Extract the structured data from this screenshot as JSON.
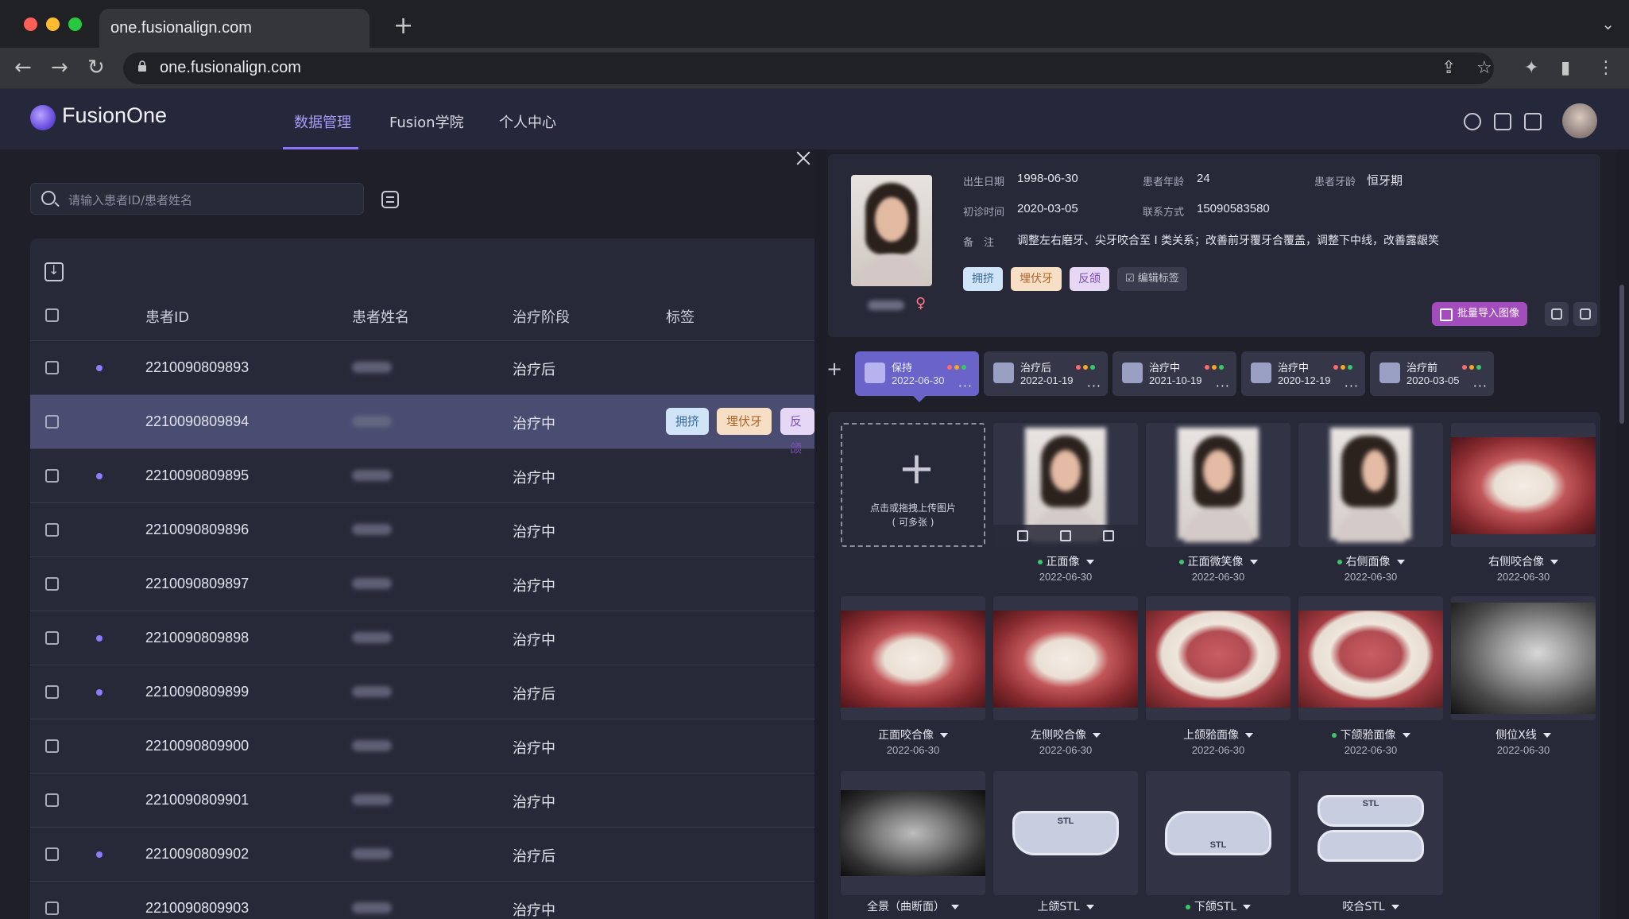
{
  "browser": {
    "tab_title": "one.fusionalign.com",
    "url": "one.fusionalign.com"
  },
  "app": {
    "logo": "FusionOne",
    "nav": [
      "数据管理",
      "Fusion学院",
      "个人中心"
    ],
    "active_nav": "数据管理"
  },
  "list": {
    "search_placeholder": "请输入患者ID/患者姓名",
    "columns": [
      "患者ID",
      "患者姓名",
      "治疗阶段",
      "标签"
    ],
    "rows": [
      {
        "id": "2210090809893",
        "stage": "治疗后",
        "dot": true
      },
      {
        "id": "2210090809894",
        "stage": "治疗中",
        "dot": false,
        "selected": true,
        "tags": [
          "拥挤",
          "埋伏牙",
          "反颌"
        ]
      },
      {
        "id": "2210090809895",
        "stage": "治疗中",
        "dot": true
      },
      {
        "id": "2210090809896",
        "stage": "治疗中",
        "dot": false
      },
      {
        "id": "2210090809897",
        "stage": "治疗中",
        "dot": false
      },
      {
        "id": "2210090809898",
        "stage": "治疗中",
        "dot": true
      },
      {
        "id": "2210090809899",
        "stage": "治疗后",
        "dot": true
      },
      {
        "id": "2210090809900",
        "stage": "治疗中",
        "dot": false
      },
      {
        "id": "2210090809901",
        "stage": "治疗中",
        "dot": false
      },
      {
        "id": "2210090809902",
        "stage": "治疗后",
        "dot": true
      },
      {
        "id": "2210090809903",
        "stage": "治疗中",
        "dot": false
      }
    ]
  },
  "patient": {
    "birth_label": "出生日期",
    "birth": "1998-06-30",
    "age_label": "患者年龄",
    "age": "24",
    "dentition_label": "患者牙龄",
    "dentition": "恒牙期",
    "first_visit_label": "初诊时间",
    "first_visit": "2020-03-05",
    "contact_label": "联系方式",
    "contact": "15090583580",
    "note_label": "备　注",
    "note": "调整左右磨牙、尖牙咬合至 I 类关系；改善前牙覆牙合覆盖，调整下中线，改善露龈笑",
    "tags": [
      "拥挤",
      "埋伏牙",
      "反颌"
    ],
    "edit_tags": "编辑标签",
    "batch_import": "批量导入图像",
    "gender_symbol": "♀"
  },
  "stages": [
    {
      "name": "保持",
      "date": "2022-06-30",
      "active": true
    },
    {
      "name": "治疗后",
      "date": "2022-01-19"
    },
    {
      "name": "治疗中",
      "date": "2021-10-19"
    },
    {
      "name": "治疗中",
      "date": "2020-12-19"
    },
    {
      "name": "治疗前",
      "date": "2020-03-05"
    }
  ],
  "gallery": {
    "upload_line1": "点击或拖拽上传图片",
    "upload_line2": "( 可多张 )",
    "items": [
      {
        "label": "正面像",
        "date": "2022-06-30",
        "dot": true
      },
      {
        "label": "正面微笑像",
        "date": "2022-06-30",
        "dot": true
      },
      {
        "label": "右侧面像",
        "date": "2022-06-30",
        "dot": true
      },
      {
        "label": "右侧咬合像",
        "date": "2022-06-30",
        "dot": false
      },
      {
        "label": "正面咬合像",
        "date": "2022-06-30",
        "dot": false
      },
      {
        "label": "左侧咬合像",
        "date": "2022-06-30",
        "dot": false
      },
      {
        "label": "上颌𬌗面像",
        "date": "2022-06-30",
        "dot": false
      },
      {
        "label": "下颌𬌗面像",
        "date": "2022-06-30",
        "dot": true
      },
      {
        "label": "侧位X线",
        "date": "2022-06-30",
        "dot": false
      },
      {
        "label": "全景（曲断面）",
        "date": "",
        "dot": false
      },
      {
        "label": "上颌STL",
        "date": "",
        "dot": false
      },
      {
        "label": "下颌STL",
        "date": "",
        "dot": true
      },
      {
        "label": "咬合STL",
        "date": "",
        "dot": false
      }
    ],
    "stl_text": "STL"
  },
  "colors": {
    "accent": "#8a74ff",
    "tag_blue": "#cfe4f7",
    "tag_orange": "#f7dfc6",
    "tag_purple": "#e6d8f5",
    "import_button": "#a24dbb"
  }
}
